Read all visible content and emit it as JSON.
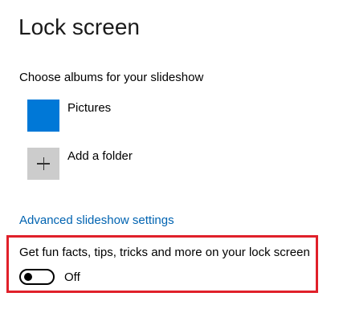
{
  "page": {
    "title": "Lock screen"
  },
  "slideshow": {
    "section_label": "Choose albums for your slideshow",
    "albums": [
      {
        "label": "Pictures",
        "icon": "folder-tile",
        "color": "#0078d7"
      },
      {
        "label": "Add a folder",
        "icon": "plus-icon",
        "color": "#cccccc"
      }
    ],
    "advanced_link": "Advanced slideshow settings"
  },
  "fun_facts": {
    "description": "Get fun facts, tips, tricks and more on your lock screen",
    "toggle_on": false,
    "toggle_state_label": "Off"
  },
  "colors": {
    "link": "#0063b1",
    "highlight_border": "#e0202a",
    "accent": "#0078d7"
  }
}
